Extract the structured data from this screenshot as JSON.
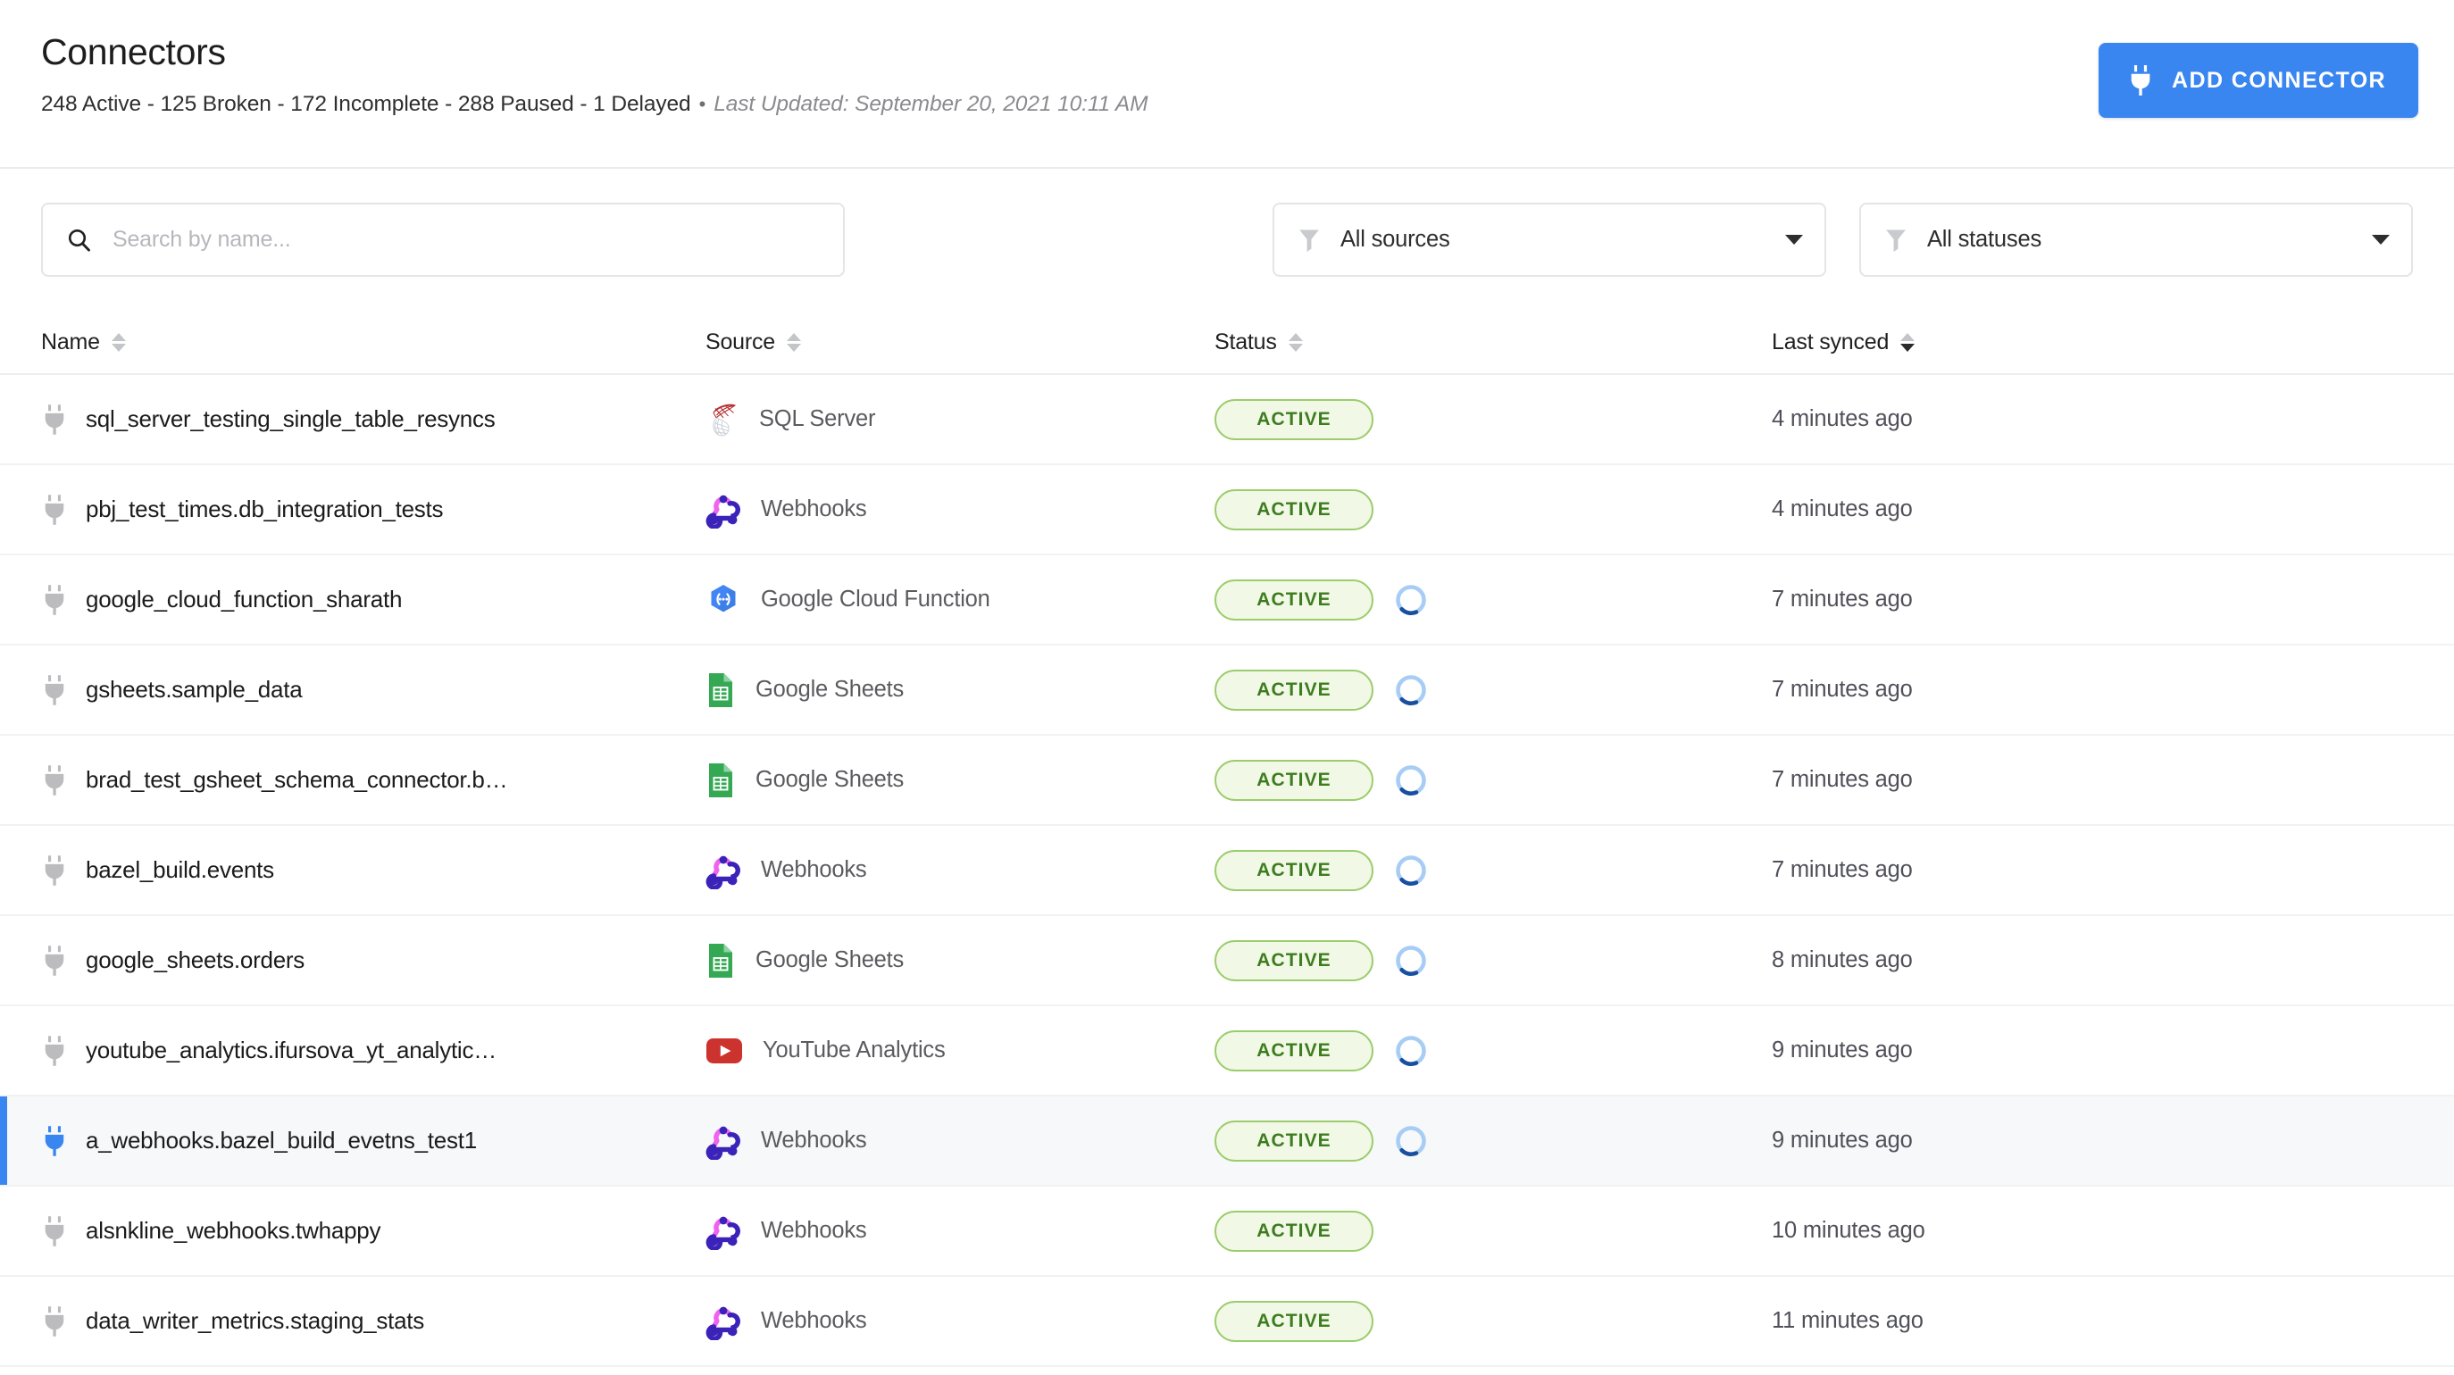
{
  "header": {
    "title": "Connectors",
    "summary": "248 Active - 125 Broken - 172 Incomplete - 288 Paused - 1 Delayed",
    "separator": "•",
    "last_updated": "Last Updated: September 20, 2021 10:11 AM",
    "add_connector_label": "ADD CONNECTOR",
    "add_connector_icon": "plug-icon",
    "accent_color": "#3a86f0"
  },
  "filters": {
    "search_placeholder": "Search by name...",
    "search_value": "",
    "search_icon": "search-icon",
    "sources_label": "All sources",
    "statuses_label": "All statuses",
    "filter_icon": "funnel-icon",
    "caret_icon": "chevron-down-icon"
  },
  "table": {
    "columns": [
      {
        "label": "Name",
        "sort": "none"
      },
      {
        "label": "Source",
        "sort": "none"
      },
      {
        "label": "Status",
        "sort": "none"
      },
      {
        "label": "Last synced",
        "sort": "desc"
      }
    ],
    "rows": [
      {
        "name": "sql_server_testing_single_table_resyncs",
        "source": "SQL Server",
        "source_icon": "sql-server-icon",
        "status": "ACTIVE",
        "syncing": false,
        "last_synced": "4 minutes ago",
        "selected": false
      },
      {
        "name": "pbj_test_times.db_integration_tests",
        "source": "Webhooks",
        "source_icon": "webhooks-icon",
        "status": "ACTIVE",
        "syncing": false,
        "last_synced": "4 minutes ago",
        "selected": false
      },
      {
        "name": "google_cloud_function_sharath",
        "source": "Google Cloud Function",
        "source_icon": "google-cloud-function-icon",
        "status": "ACTIVE",
        "syncing": true,
        "last_synced": "7 minutes ago",
        "selected": false
      },
      {
        "name": "gsheets.sample_data",
        "source": "Google Sheets",
        "source_icon": "google-sheets-icon",
        "status": "ACTIVE",
        "syncing": true,
        "last_synced": "7 minutes ago",
        "selected": false
      },
      {
        "name": "brad_test_gsheet_schema_connector.b…",
        "source": "Google Sheets",
        "source_icon": "google-sheets-icon",
        "status": "ACTIVE",
        "syncing": true,
        "last_synced": "7 minutes ago",
        "selected": false
      },
      {
        "name": "bazel_build.events",
        "source": "Webhooks",
        "source_icon": "webhooks-icon",
        "status": "ACTIVE",
        "syncing": true,
        "last_synced": "7 minutes ago",
        "selected": false
      },
      {
        "name": "google_sheets.orders",
        "source": "Google Sheets",
        "source_icon": "google-sheets-icon",
        "status": "ACTIVE",
        "syncing": true,
        "last_synced": "8 minutes ago",
        "selected": false
      },
      {
        "name": "youtube_analytics.ifursova_yt_analytic…",
        "source": "YouTube Analytics",
        "source_icon": "youtube-icon",
        "status": "ACTIVE",
        "syncing": true,
        "last_synced": "9 minutes ago",
        "selected": false
      },
      {
        "name": "a_webhooks.bazel_build_evetns_test1",
        "source": "Webhooks",
        "source_icon": "webhooks-icon",
        "status": "ACTIVE",
        "syncing": true,
        "last_synced": "9 minutes ago",
        "selected": true
      },
      {
        "name": "alsnkline_webhooks.twhappy",
        "source": "Webhooks",
        "source_icon": "webhooks-icon",
        "status": "ACTIVE",
        "syncing": false,
        "last_synced": "10 minutes ago",
        "selected": false
      },
      {
        "name": "data_writer_metrics.staging_stats",
        "source": "Webhooks",
        "source_icon": "webhooks-icon",
        "status": "ACTIVE",
        "syncing": false,
        "last_synced": "11 minutes ago",
        "selected": false
      }
    ],
    "status_colors": {
      "active_bg": "#f1f8e6",
      "active_border": "#9ccd6c",
      "active_text": "#3d7c1f"
    }
  }
}
